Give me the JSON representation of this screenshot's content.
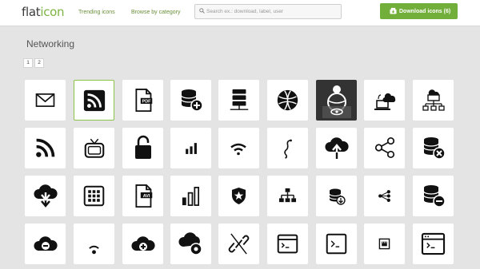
{
  "app": {
    "logo_part1": "flat",
    "logo_part2": "icon"
  },
  "header": {
    "nav": [
      "Trending icons",
      "Browse by category"
    ],
    "search_placeholder": "Search ex.: download, label, user",
    "download_button": "Download icons (6)"
  },
  "collection": {
    "title": "Networking",
    "pages": [
      "1",
      "2"
    ]
  },
  "colors": {
    "brand_green": "#72ae3a",
    "selected_border": "#8bc34a",
    "background": "#e4e4e4"
  },
  "icons": [
    [
      "envelope-icon",
      "rss-feed-icon",
      "pdf-file-icon",
      "database-add-icon",
      "server-icon",
      "globe-icon",
      "globe-view-icon",
      "cloud-laptop-icon",
      "network-hierarchy-icon"
    ],
    [
      "rss-icon",
      "tv-icon",
      "padlock-icon",
      "signal-bars-icon",
      "wifi-icon",
      "snake-cable-icon",
      "cloud-upload-icon",
      "share-icon",
      "database-remove-icon"
    ],
    [
      "cloud-download-icon",
      "grid-keypad-icon",
      "avi-file-icon",
      "bar-chart-icon",
      "shield-star-icon",
      "network-tree-icon",
      "database-download-icon",
      "share-nodes-icon",
      "database-minus-icon"
    ],
    [
      "cloud-minus-icon",
      "wifi-low-icon",
      "cloud-add-icon",
      "cloud-settings-icon",
      "broken-link-icon",
      "terminal-window-icon",
      "terminal-prompt-icon",
      "ethernet-port-icon",
      "browser-console-icon"
    ]
  ]
}
